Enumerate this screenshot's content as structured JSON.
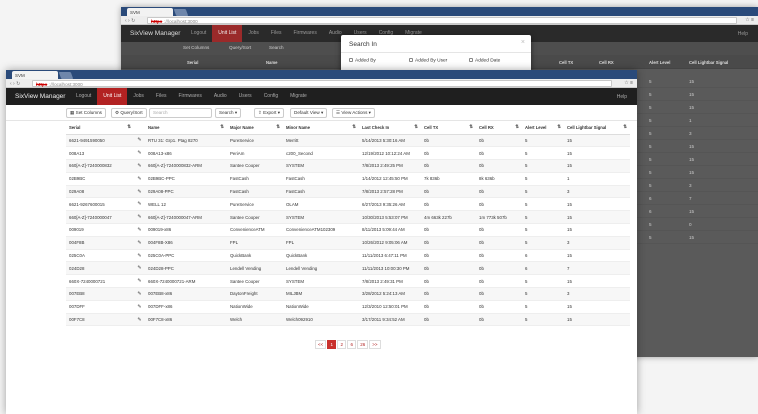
{
  "browser": {
    "tab_title": "SVM",
    "url_secure": "https",
    "url_rest": "://localhost:3000"
  },
  "app": {
    "brand": "SixView Manager",
    "menu": [
      "Logout",
      "Unit List",
      "Jobs",
      "Files",
      "Firmwares",
      "Audio",
      "Users",
      "Config",
      "Migrate"
    ],
    "active_menu": "Unit List",
    "help": "Help"
  },
  "toolbar": {
    "set_columns": "Set Columns",
    "query_sort": "Query/Sort",
    "search_placeholder": "Search",
    "search_button": "Search",
    "export": "Export",
    "default_view": "Default View",
    "view_actions": "View Actions"
  },
  "modal": {
    "title": "Search In",
    "close": "×",
    "options": [
      "Added By",
      "Added By User",
      "Added Date"
    ]
  },
  "table": {
    "headers": [
      "Serial",
      "",
      "Name",
      "Major Name",
      "Minor Name",
      "Last Check In",
      "Cell TX",
      "Cell RX",
      "Alert Level",
      "Cell Lightbar Signal"
    ],
    "rows": [
      [
        "6621-9491590050",
        "RTU 31: Grp1. Ptag 8270",
        "PureService",
        "Merritt",
        "5/14/2013 5:30:16 AM",
        "0b",
        "0b",
        "5",
        "15"
      ],
      [
        "008A13",
        "008A13-x86",
        "PeriAm",
        "c200_Second",
        "12/19/2012 10:12:24 AM",
        "0b",
        "0b",
        "5",
        "15"
      ],
      [
        "660[A-Z]-7240000832",
        "660[A-Z]-7240000832-ARM",
        "Santee Cooper",
        "SYSTEM",
        "7/8/2013 2:49:25 PM",
        "0b",
        "0b",
        "5",
        "15"
      ],
      [
        "02B9BC",
        "02B9BC-PPC",
        "FastCash",
        "FastCash",
        "1/14/2012 12:45:50 PM",
        "7k 836b",
        "8k 636b",
        "5",
        "1"
      ],
      [
        "029A08",
        "029A08-PPC",
        "FastCash",
        "FastCash",
        "7/8/2013 2:57:28 PM",
        "0b",
        "0b",
        "5",
        "3"
      ],
      [
        "6621-9267600015",
        "WELL 12",
        "PureService",
        "OLAM",
        "6/27/2013 9:35:26 AM",
        "0b",
        "0b",
        "5",
        "15"
      ],
      [
        "660[A-Z]-7240000047",
        "660[A-Z]-7240000047-ARM",
        "Santee Cooper",
        "SYSTEM",
        "10/30/2013 5:53:07 PM",
        "4m 663k 227b",
        "1m 773k 507b",
        "5",
        "15"
      ],
      [
        "009019",
        "009019-x86",
        "ConvenienceATM",
        "ConvenienceATM102309",
        "8/11/2013 5:09:44 AM",
        "0b",
        "0b",
        "5",
        "15"
      ],
      [
        "004F8B",
        "004F8B-X86",
        "FPL",
        "FPL",
        "10/26/2012 9:05:06 AM",
        "0b",
        "0b",
        "5",
        "3"
      ],
      [
        "025C0A",
        "025C0A-PPC",
        "QuickBank",
        "QuickBank",
        "11/11/2013 6:47:11 PM",
        "0b",
        "0b",
        "6",
        "15"
      ],
      [
        "024D28",
        "024D28-PPC",
        "Lendell Vending",
        "Lendell Vending",
        "11/11/2013 10:00:30 PM",
        "0b",
        "0b",
        "6",
        "7"
      ],
      [
        "660X-7240000721",
        "660X-7240000721-ARM",
        "Santee Cooper",
        "SYSTEM",
        "7/8/2013 2:49:31 PM",
        "0b",
        "0b",
        "5",
        "15"
      ],
      [
        "007EB8",
        "007EB8-x86",
        "DaytonFreight",
        "MILJBM",
        "3/28/2012 5:24:13 AM",
        "0b",
        "0b",
        "5",
        "3"
      ],
      [
        "007DFF",
        "007DFF-x86",
        "NationWide",
        "NationWide",
        "12/3/2010 12:50:01 PM",
        "0b",
        "0b",
        "5",
        "15"
      ],
      [
        "00F7C8",
        "00F7C8-x86",
        "Welch",
        "Welch092910",
        "3/17/2011 9:34:52 AM",
        "0b",
        "0b",
        "5",
        "15"
      ]
    ]
  },
  "back_table": {
    "headers": [
      "Serial",
      "Name",
      "Major Name",
      "Minor Name",
      "Cell TX",
      "Cell RX",
      "Alert Level",
      "Cell Lightbar Signal"
    ],
    "rows": [
      [
        "0b",
        "5",
        "5",
        "15"
      ],
      [
        "0b",
        "0b",
        "5",
        "15"
      ],
      [
        "0b",
        "0b",
        "5",
        "15"
      ],
      [
        "8k 636b",
        "5",
        "5",
        "1"
      ],
      [
        "0b",
        "0b",
        "5",
        "3"
      ],
      [
        "0b",
        "0b",
        "5",
        "15"
      ],
      [
        "1m 773k 507b",
        "5",
        "5",
        "15"
      ],
      [
        "0b",
        "0b",
        "5",
        "15"
      ],
      [
        "0b",
        "0b",
        "5",
        "3"
      ],
      [
        "0b",
        "0b",
        "6",
        "7"
      ],
      [
        "0b",
        "0b",
        "6",
        "15"
      ],
      [
        "0b",
        "0b",
        "5",
        "0"
      ],
      [
        "0b",
        "0b",
        "5",
        "15"
      ]
    ]
  },
  "pager": [
    "<<",
    "1",
    "2",
    "6",
    "26",
    ">>"
  ],
  "pager_active": "1"
}
